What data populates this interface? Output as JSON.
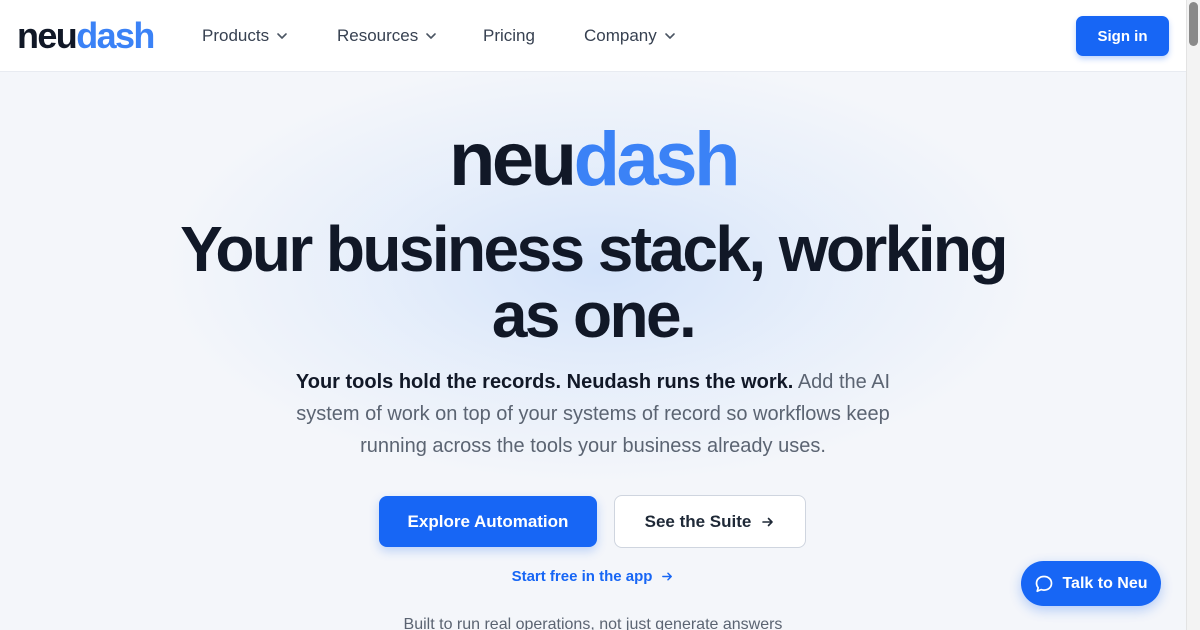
{
  "header": {
    "logo": {
      "part1": "neu",
      "part2": "dash"
    },
    "nav": [
      {
        "label": "Products",
        "has_dropdown": true
      },
      {
        "label": "Resources",
        "has_dropdown": true
      },
      {
        "label": "Pricing",
        "has_dropdown": false
      },
      {
        "label": "Company",
        "has_dropdown": true
      }
    ],
    "sign_in_label": "Sign in"
  },
  "hero": {
    "logo": {
      "part1": "neu",
      "part2": "dash"
    },
    "headline_line1": "Your business stack, working",
    "headline_line2": "as one.",
    "subtext_strong": "Your tools hold the records. Neudash runs the work.",
    "subtext_rest": " Add the AI system of work on top of your systems of record so workflows keep running across the tools your business already uses.",
    "primary_cta": "Explore Automation",
    "secondary_cta": "See the Suite",
    "tertiary_link": "Start free in the app",
    "tagline": "Built to run real operations, not just generate answers"
  },
  "chat_widget": {
    "label": "Talk to Neu"
  },
  "colors": {
    "brand_blue": "#1766f5",
    "logo_accent": "#3b82f6",
    "text_dark": "#111827",
    "text_muted": "#5b6472"
  },
  "icons": {
    "nav_dropdown": "chevron-down-icon",
    "cta_arrow": "arrow-right-icon",
    "chat": "chat-bubble-icon"
  }
}
